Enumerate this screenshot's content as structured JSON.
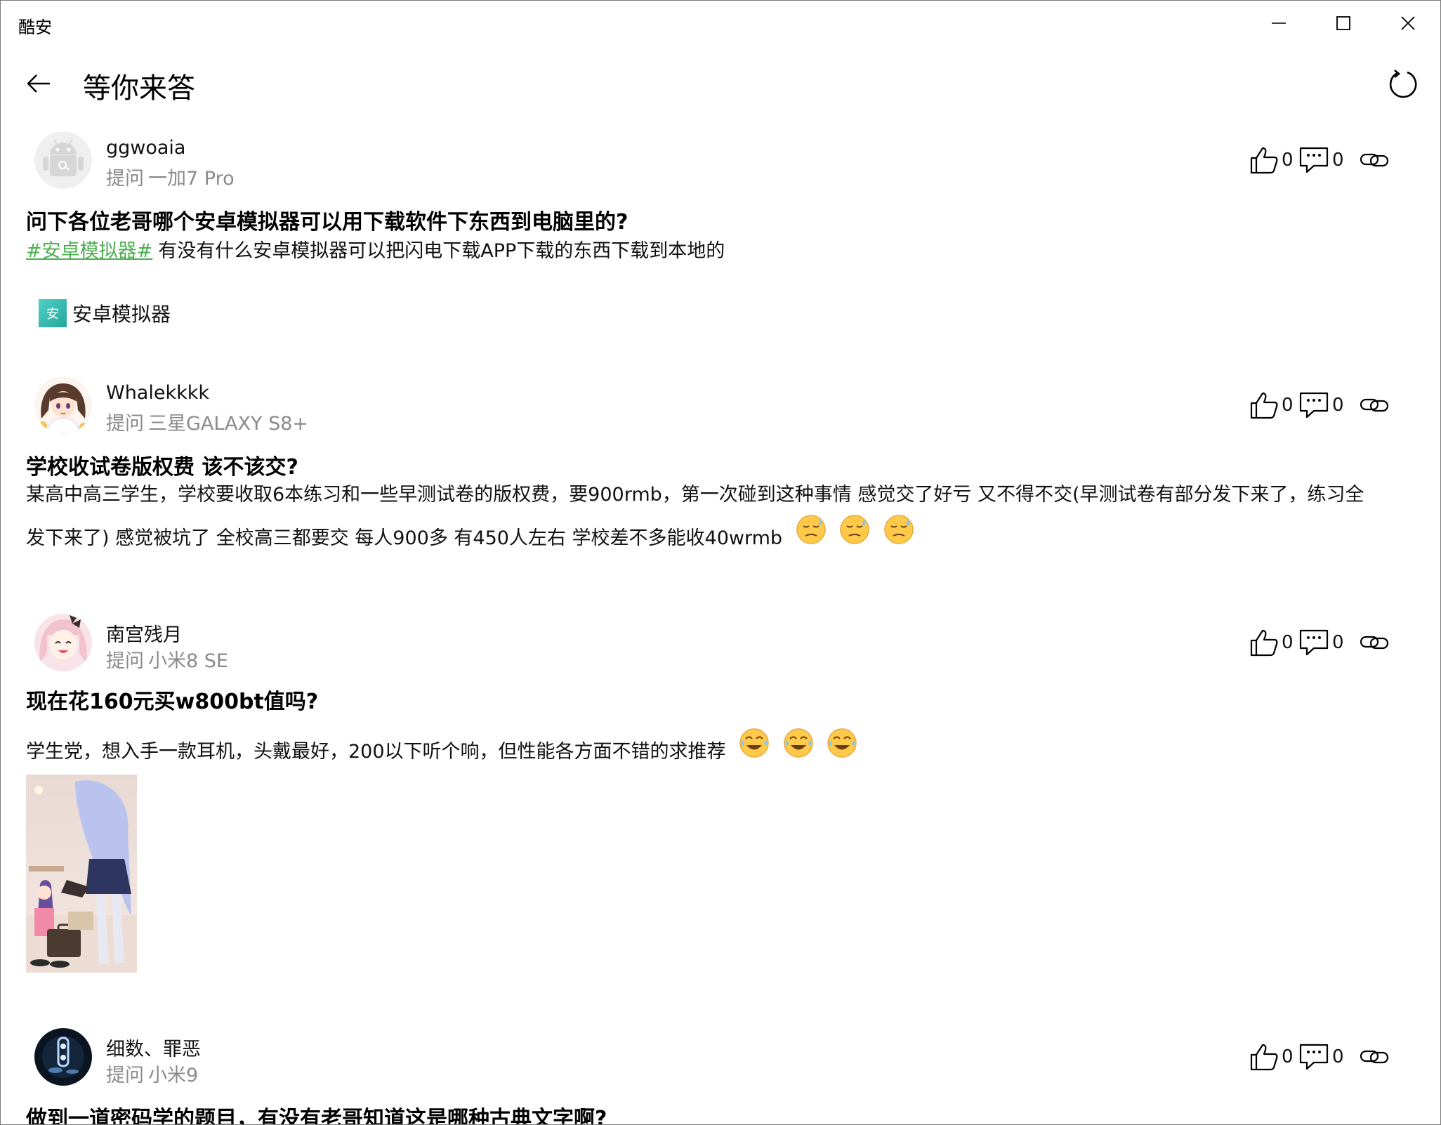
{
  "window": {
    "app_title": "酷安",
    "minimize_icon": "minimize-icon",
    "maximize_icon": "maximize-icon",
    "close_icon": "close-icon"
  },
  "header": {
    "title": "等你来答",
    "back_icon": "arrow-left-icon",
    "refresh_icon": "refresh-icon"
  },
  "colors": {
    "hashtag": "#4caf50",
    "meta_text": "#8a8a8a",
    "topic_icon": "#26a69a"
  },
  "posts": [
    {
      "username": "ggwoaia",
      "meta_type": "提问",
      "device": "一加7 Pro",
      "likes": "0",
      "comments": "0",
      "title": "问下各位老哥哪个安卓模拟器可以用下载软件下东西到电脑里的?",
      "hashtag": "#安卓模拟器#",
      "body": "有没有什么安卓模拟器可以把闪电下载APP下载的东西下载到本地的",
      "topic": {
        "icon_text": "安",
        "label": "安卓模拟器"
      }
    },
    {
      "username": "Whalekkkk",
      "meta_type": "提问",
      "device": "三星GALAXY S8+",
      "likes": "0",
      "comments": "0",
      "title": "学校收试卷版权费 该不该交?",
      "body_line1": "某高中高三学生，学校要收取6本练习和一些早测试卷的版权费，要900rmb，第一次碰到这种事情 感觉交了好亏 又不得不交(早测试卷有部分发下来了，练习全",
      "body_line2": "发下来了) 感觉被坑了 全校高三都要交 每人900多 有450人左右 学校差不多能收40wrmb"
    },
    {
      "username": "南宫残月",
      "meta_type": "提问",
      "device": "小米8 SE",
      "likes": "0",
      "comments": "0",
      "title": "现在花160元买w800bt值吗?",
      "body": "学生党，想入手一款耳机，头戴最好，200以下听个响，但性能各方面不错的求推荐"
    },
    {
      "username": "细数、罪恶",
      "meta_type": "提问",
      "device": "小米9",
      "likes": "0",
      "comments": "0",
      "title": "做到一道密码学的题目，有没有老哥知道这是哪种古典文字啊?"
    }
  ]
}
